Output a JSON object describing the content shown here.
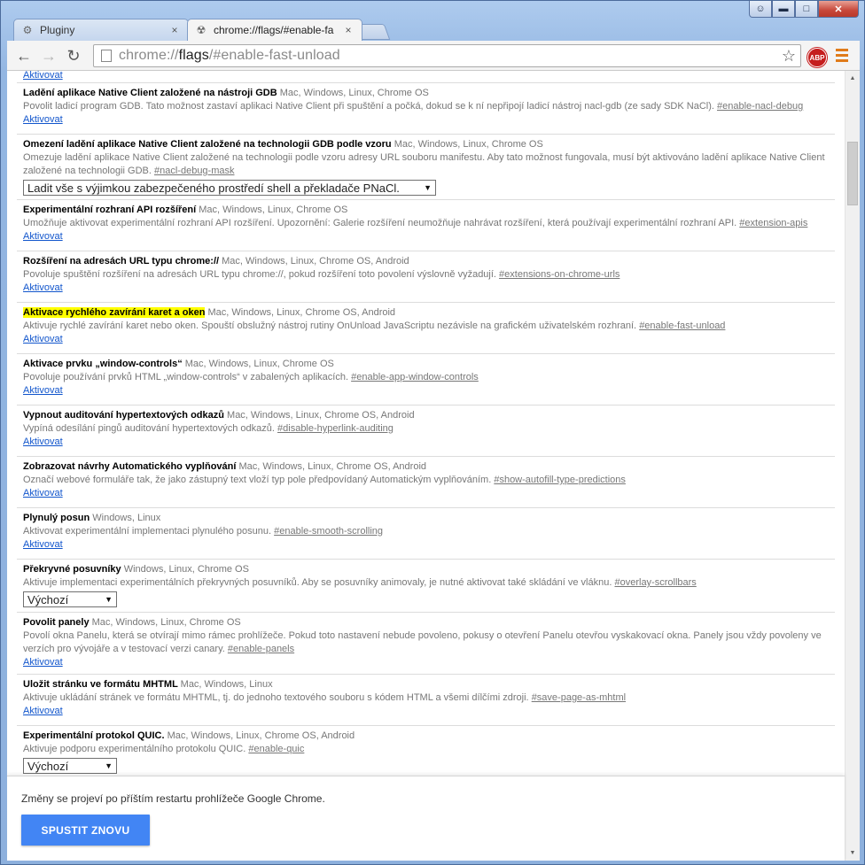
{
  "tabs": [
    {
      "label": "Pluginy",
      "icon": "puzzle-icon",
      "close": "×"
    },
    {
      "label": "chrome://flags/#enable-fa",
      "icon": "radiation-icon",
      "close": "×"
    }
  ],
  "omnibox": {
    "url_scheme": "chrome://",
    "url_host": "flags",
    "url_rest": "/#enable-fast-unload"
  },
  "extensions": {
    "abp_label": "ABP"
  },
  "experiments": [
    {
      "title": "",
      "platforms": "",
      "description": "",
      "anchor": "",
      "action": "Aktivovat"
    },
    {
      "title": "Ladění aplikace Native Client založené na nástroji GDB",
      "platforms": "Mac, Windows, Linux, Chrome OS",
      "description": "Povolit ladicí program GDB. Tato možnost zastaví aplikaci Native Client při spuštění a počká, dokud se k ní nepřipojí ladicí nástroj nacl-gdb (ze sady SDK NaCl).",
      "anchor": "#enable-nacl-debug",
      "action": "Aktivovat"
    },
    {
      "title": "Omezení ladění aplikace Native Client založené na technologii GDB podle vzoru",
      "platforms": "Mac, Windows, Linux, Chrome OS",
      "description": "Omezuje ladění aplikace Native Client založené na technologii podle vzoru adresy URL souboru manifestu. Aby tato možnost fungovala, musí být aktivováno ladění aplikace Native Client založené na technologii GDB.",
      "anchor": "#nacl-debug-mask",
      "select": "Ladit vše s výjimkou zabezpečeného prostředí shell a překladače PNaCl."
    },
    {
      "title": "Experimentální rozhraní API rozšíření",
      "platforms": "Mac, Windows, Linux, Chrome OS",
      "description": "Umožňuje aktivovat experimentální rozhraní API rozšíření. Upozornění: Galerie rozšíření neumožňuje nahrávat rozšíření, která používají experimentální rozhraní API.",
      "anchor": "#extension-apis",
      "action": "Aktivovat"
    },
    {
      "title": "Rozšíření na adresách URL typu chrome://",
      "platforms": "Mac, Windows, Linux, Chrome OS, Android",
      "description": "Povoluje spuštění rozšíření na adresách URL typu chrome://, pokud rozšíření toto povolení výslovně vyžadují.",
      "anchor": "#extensions-on-chrome-urls",
      "action": "Aktivovat"
    },
    {
      "title": "Aktivace rychlého zavírání karet a oken",
      "highlight": true,
      "platforms": "Mac, Windows, Linux, Chrome OS, Android",
      "description": "Aktivuje rychlé zavírání karet nebo oken. Spouští obslužný nástroj rutiny OnUnload JavaScriptu nezávisle na grafickém uživatelském rozhraní.",
      "anchor": "#enable-fast-unload",
      "action": "Aktivovat"
    },
    {
      "title": "Aktivace prvku „window-controls“",
      "platforms": "Mac, Windows, Linux, Chrome OS",
      "description": "Povoluje používání prvků HTML „window-controls“ v zabalených aplikacích.",
      "anchor": "#enable-app-window-controls",
      "action": "Aktivovat"
    },
    {
      "title": "Vypnout auditování hypertextových odkazů",
      "platforms": "Mac, Windows, Linux, Chrome OS, Android",
      "description": "Vypíná odesílání pingů auditování hypertextových odkazů.",
      "anchor": "#disable-hyperlink-auditing",
      "action": "Aktivovat"
    },
    {
      "title": "Zobrazovat návrhy Automatického vyplňování",
      "platforms": "Mac, Windows, Linux, Chrome OS, Android",
      "description": "Označí webové formuláře tak, že jako zástupný text vloží typ pole předpovídaný Automatickým vyplňováním.",
      "anchor": "#show-autofill-type-predictions",
      "action": "Aktivovat"
    },
    {
      "title": "Plynulý posun",
      "platforms": "Windows, Linux",
      "description": "Aktivovat experimentální implementaci plynulého posunu.",
      "anchor": "#enable-smooth-scrolling",
      "action": "Aktivovat"
    },
    {
      "title": "Překryvné posuvníky",
      "platforms": "Windows, Linux, Chrome OS",
      "description": "Aktivuje implementaci experimentálních překryvných posuvníků. Aby se posuvníky animovaly, je nutné aktivovat také skládání ve vláknu.",
      "anchor": "#overlay-scrollbars",
      "select": "Výchozí"
    },
    {
      "title": "Povolit panely",
      "platforms": "Mac, Windows, Linux, Chrome OS",
      "description": "Povolí okna Panelu, která se otvírají mimo rámec prohlížeče. Pokud toto nastavení nebude povoleno, pokusy o otevření Panelu otevřou vyskakovací okna. Panely jsou vždy povoleny ve verzích pro vývojáře a v testovací verzi canary.",
      "anchor": "#enable-panels",
      "action": "Aktivovat"
    },
    {
      "title": "Uložit stránku ve formátu MHTML",
      "platforms": "Mac, Windows, Linux",
      "description": "Aktivuje ukládání stránek ve formátu MHTML, tj. do jednoho textového souboru s kódem HTML a všemi dílčími zdroji.",
      "anchor": "#save-page-as-mhtml",
      "action": "Aktivovat"
    },
    {
      "title": "Experimentální protokol QUIC.",
      "platforms": "Mac, Windows, Linux, Chrome OS, Android",
      "description": "Aktivuje podporu experimentálního protokolu QUIC.",
      "anchor": "#enable-quic",
      "select": "Výchozí"
    }
  ],
  "restart": {
    "message": "Změny se projeví po příštím restartu prohlížeče Google Chrome.",
    "button": "SPUSTIT ZNOVU"
  }
}
